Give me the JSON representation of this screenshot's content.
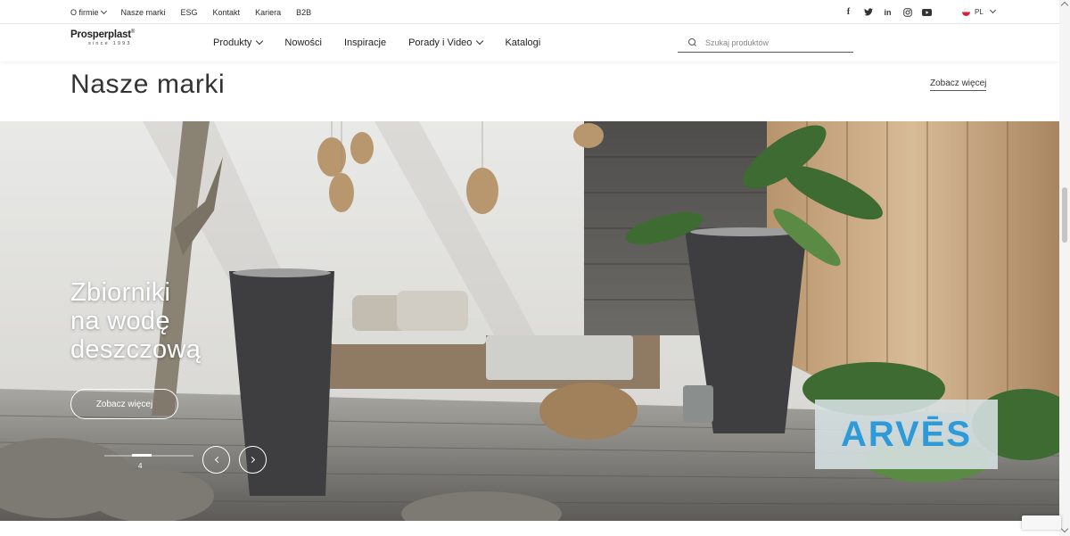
{
  "topbar": {
    "links": [
      "O firmie",
      "Nasze marki",
      "ESG",
      "Kontakt",
      "Kariera",
      "B2B"
    ],
    "social": [
      {
        "icon": "facebook-icon",
        "glyph": "f"
      },
      {
        "icon": "twitter-icon",
        "glyph": "🐦"
      },
      {
        "icon": "linkedin-icon",
        "glyph": "in"
      },
      {
        "icon": "instagram-icon",
        "glyph": "◎"
      },
      {
        "icon": "youtube-icon",
        "glyph": "▶"
      }
    ],
    "language": "PL"
  },
  "header": {
    "logo_text": "Prosperplast",
    "logo_mark": "®",
    "logo_since": "since 1993",
    "nav": [
      "Produkty",
      "Nowości",
      "Inspiracje",
      "Porady i Video",
      "Katalogi"
    ],
    "search_placeholder": "Szukaj produktów"
  },
  "section": {
    "title": "Nasze marki",
    "see_more": "Zobacz więcej"
  },
  "hero": {
    "heading_lines": [
      "Zbiorniki",
      "na wodę",
      "deszczową"
    ],
    "button": "Zobacz więcej",
    "slide_number": "4",
    "brand_badge": "ARVĒS",
    "brand_color": "#2e9ad8"
  }
}
